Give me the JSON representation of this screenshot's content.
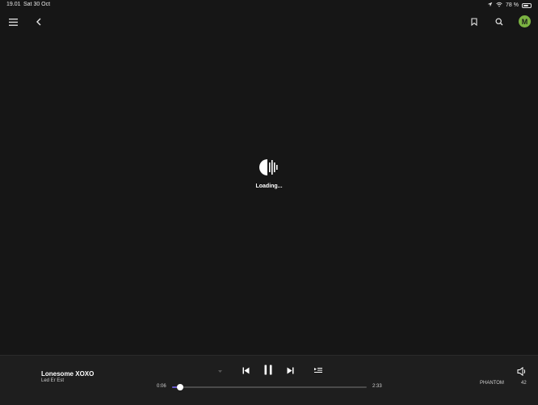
{
  "status_bar": {
    "time": "19.01",
    "date": "Sat 30 Oct",
    "battery_percent": "78 %",
    "battery_level": 0.78
  },
  "top_bar": {
    "avatar_initial": "M",
    "avatar_color": "#7cb342",
    "icons": [
      "menu-icon",
      "back-icon",
      "bookmark-icon",
      "search-icon"
    ]
  },
  "loading": {
    "label": "Loading..."
  },
  "player": {
    "track_title": "Lonesome XOXO",
    "track_artist": "Led Er Est",
    "elapsed": "0:06",
    "duration": "2:33",
    "progress": 0.04,
    "device": "PHANTOM",
    "volume": "42",
    "accent_color": "#6a5acd"
  }
}
